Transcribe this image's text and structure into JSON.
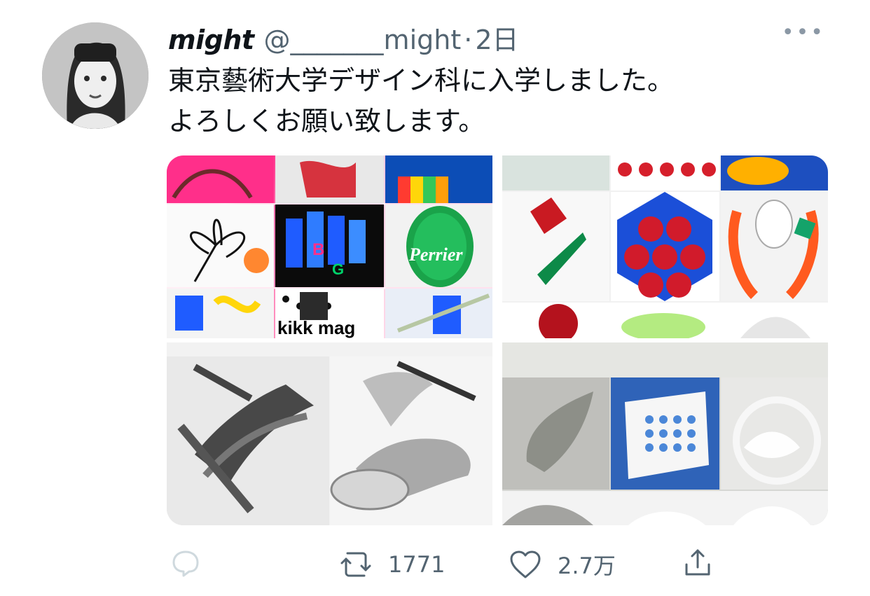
{
  "tweet": {
    "display_name": "might",
    "handle": "@_______might",
    "separator": "·",
    "time": "2日",
    "more": "•••",
    "text": "東京藝術大学デザイン科に入学しました。\nよろしくお願い致します。"
  },
  "actions": {
    "retweet_count": "1771",
    "like_count": "2.7万"
  },
  "media": {
    "tiles": [
      {
        "label": "collage-colorful"
      },
      {
        "label": "still-life"
      },
      {
        "label": "pencil-drawing"
      },
      {
        "label": "paper-sculpture"
      }
    ],
    "tile1_text": "kikk mag",
    "tile1_overlay_text": "Perrier"
  }
}
